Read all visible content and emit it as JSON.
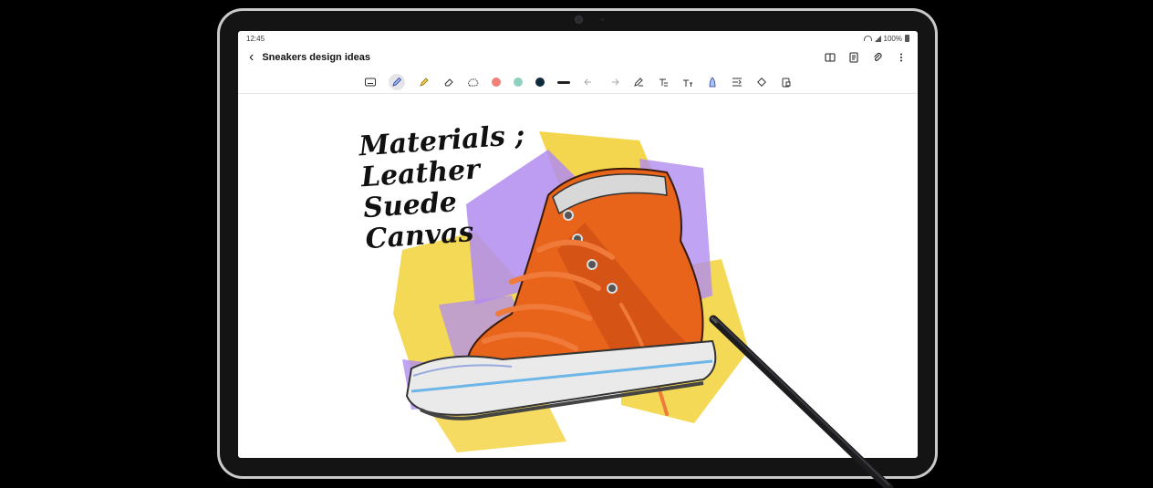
{
  "status": {
    "time": "12:45",
    "battery": "100%"
  },
  "note": {
    "title": "Sneakers design ideas"
  },
  "appbar_icons": [
    "back-icon",
    "book-view-icon",
    "page-icon",
    "attach-icon",
    "more-icon"
  ],
  "toolbar": {
    "tools": [
      "keyboard-icon",
      "pen-icon",
      "highlighter-icon",
      "eraser-icon",
      "lasso-icon"
    ],
    "active_tool": "pen-icon",
    "colors": [
      "#f08078",
      "#8fd0c0",
      "#0f2a3a"
    ],
    "actions": [
      "undo-icon",
      "redo-icon",
      "pen-settings-icon",
      "text-style-icon",
      "text-size-icon",
      "brush-icon",
      "insert-icon",
      "shape-icon",
      "lock-icon"
    ]
  },
  "canvas": {
    "handwriting": [
      "Materials ;",
      "Leather",
      "Suede",
      "Canvas"
    ]
  },
  "palette": {
    "shoe_orange": "#e8641a",
    "paint_yellow": "#f2d23a",
    "paint_purple": "#b08cf0",
    "lace": "#f07a3a",
    "sole": "#eaeaea"
  }
}
